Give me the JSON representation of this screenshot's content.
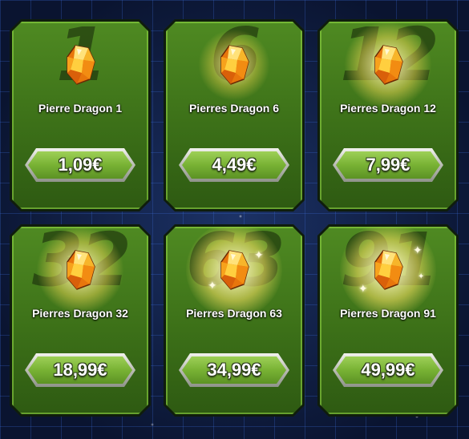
{
  "shop": {
    "items": [
      {
        "label": "Pierre Dragon 1",
        "price": "1,09€",
        "bg_number": "1",
        "glow": 1
      },
      {
        "label": "Pierres Dragon 6",
        "price": "4,49€",
        "bg_number": "6",
        "glow": 2
      },
      {
        "label": "Pierres Dragon 12",
        "price": "7,99€",
        "bg_number": "12",
        "glow": 3
      },
      {
        "label": "Pierres Dragon 32",
        "price": "18,99€",
        "bg_number": "32",
        "glow": 3
      },
      {
        "label": "Pierres Dragon 63",
        "price": "34,99€",
        "bg_number": "63",
        "glow": 4
      },
      {
        "label": "Pierres Dragon 91",
        "price": "49,99€",
        "bg_number": "91",
        "glow": 4
      }
    ]
  },
  "colors": {
    "card_green": "#3c7018",
    "button_green": "#78b234",
    "crystal_gold": "#f5b21a",
    "background": "#0b1838"
  },
  "icons": {
    "currency": "dragon-stone-icon"
  }
}
